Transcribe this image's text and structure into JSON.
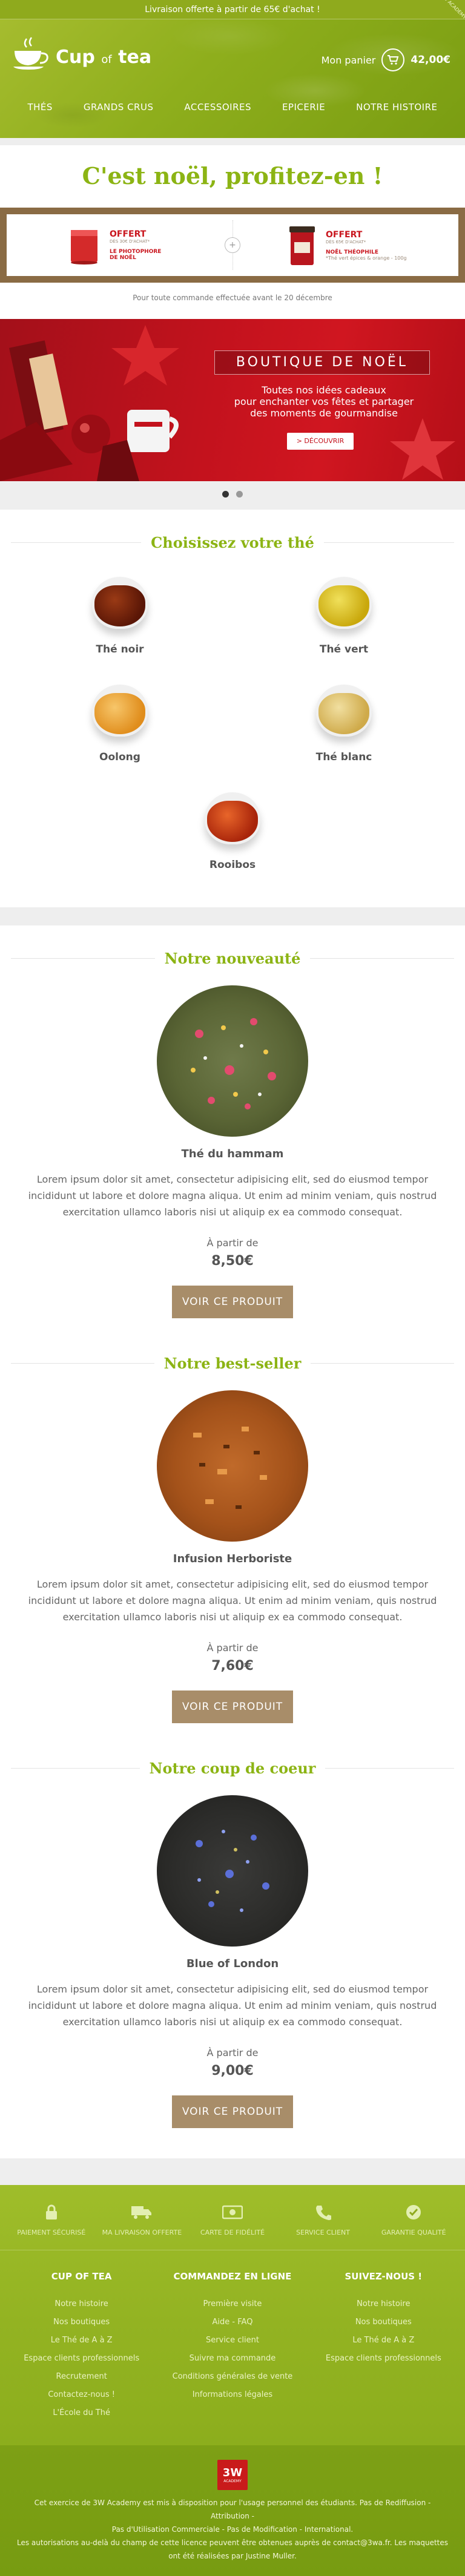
{
  "topbar": {
    "text": "Livraison offerte à partir de 65€ d'achat !",
    "ribbon": "3W ACADEMY"
  },
  "brand": {
    "name_part1": "Cup",
    "name_of": "of",
    "name_part2": "tea"
  },
  "cart": {
    "label": "Mon panier",
    "amount": "42,00€"
  },
  "nav": {
    "items": [
      "THÉS",
      "GRANDS CRUS",
      "ACCESSOIRES",
      "EPICERIE",
      "NOTRE HISTOIRE"
    ]
  },
  "promo": {
    "title": "C'est noël, profitez-en !",
    "offer1": {
      "title": "OFFERT",
      "sub": "DÈS 30€ D'ACHAT*",
      "name_line1": "LE PHOTOPHORE",
      "name_line2": "DE NOËL"
    },
    "offer2": {
      "title": "OFFERT",
      "sub": "DÈS 65€ D'ACHAT*",
      "name": "NOËL THÉOPHILE",
      "extra": "*Thé vert épices & orange - 100g"
    },
    "plus": "+",
    "note": "Pour toute commande effectuée avant le 20 décembre"
  },
  "banner": {
    "title": "BOUTIQUE DE NOËL",
    "text_line1": "Toutes nos idées cadeaux",
    "text_line2": "pour enchanter vos fêtes et partager",
    "text_line3": "des moments de gourmandise",
    "button": "> DÉCOUVRIR"
  },
  "teas": {
    "heading": "Choisissez votre thé",
    "items": [
      {
        "label": "Thé noir",
        "color": "#6b1f0a"
      },
      {
        "label": "Thé vert",
        "color": "#d6b814"
      },
      {
        "label": "Oolong",
        "color": "#e89a2a"
      },
      {
        "label": "Thé blanc",
        "color": "#d7b75a"
      },
      {
        "label": "Rooibos",
        "color": "#c0330c"
      }
    ]
  },
  "products": [
    {
      "heading": "Notre nouveauté",
      "name": "Thé du hammam",
      "desc": "Lorem ipsum dolor sit amet, consectetur adipisicing elit, sed do eiusmod tempor incididunt ut labore et dolore magna aliqua. Ut enim ad minim veniam, quis nostrud exercitation ullamco laboris nisi ut aliquip ex ea commodo consequat.",
      "from": "À partir de",
      "price": "8,50€",
      "button": "VOIR CE PRODUIT"
    },
    {
      "heading": "Notre best-seller",
      "name": "Infusion Herboriste",
      "desc": "Lorem ipsum dolor sit amet, consectetur adipisicing elit, sed do eiusmod tempor incididunt ut labore et dolore magna aliqua. Ut enim ad minim veniam, quis nostrud exercitation ullamco laboris nisi ut aliquip ex ea commodo consequat.",
      "from": "À partir de",
      "price": "7,60€",
      "button": "VOIR CE PRODUIT"
    },
    {
      "heading": "Notre coup de coeur",
      "name": "Blue of London",
      "desc": "Lorem ipsum dolor sit amet, consectetur adipisicing elit, sed do eiusmod tempor incididunt ut labore et dolore magna aliqua. Ut enim ad minim veniam, quis nostrud exercitation ullamco laboris nisi ut aliquip ex ea commodo consequat.",
      "from": "À partir de",
      "price": "9,00€",
      "button": "VOIR CE PRODUIT"
    }
  ],
  "features": [
    "PAIEMENT SÉCURISÉ",
    "MA LIVRAISON OFFERTE",
    "CARTE DE FIDÉLITÉ",
    "SERVICE CLIENT",
    "GARANTIE QUALITÉ"
  ],
  "footer": {
    "col1": {
      "title": "CUP OF TEA",
      "links": [
        "Notre histoire",
        "Nos boutiques",
        "Le Thé de A à Z",
        "Espace clients professionnels",
        "Recrutement",
        "Contactez-nous !",
        "L'École du Thé"
      ]
    },
    "col2": {
      "title": "COMMANDEZ EN LIGNE",
      "links": [
        "Première visite",
        "Aide - FAQ",
        "Service client",
        "Suivre ma commande",
        "Conditions générales de vente",
        "Informations légales"
      ]
    },
    "col3": {
      "title": "SUIVEZ-NOUS !",
      "links": [
        "Notre histoire",
        "Nos boutiques",
        "Le Thé de A à Z",
        "Espace clients professionnels"
      ]
    },
    "logo_main": "3W",
    "logo_sub": "ACADEMY",
    "copy_line1": "Cet exercice de 3W Academy est mis à disposition pour l'usage personnel des étudiants. Pas de Rediffusion - Attribution -",
    "copy_line2": "Pas d'Utilisation Commerciale - Pas de Modification - International.",
    "copy_line3": "Les autorisations au-delà du champ de cette licence peuvent être obtenues auprès de contact@3wa.fr. Les maquettes",
    "copy_line4": "ont été réalisées par Justine Muller."
  },
  "colors": {
    "accent_green": "#8cb414",
    "christmas_red": "#c3121d",
    "button_brown": "#a88d69"
  }
}
